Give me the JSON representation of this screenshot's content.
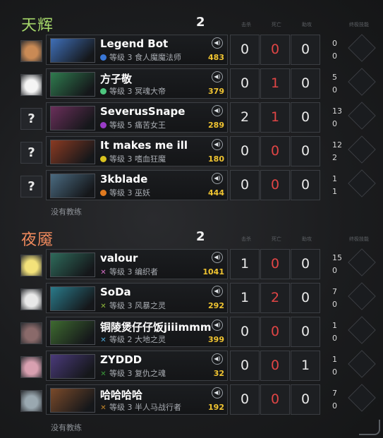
{
  "columns": {
    "kills": "击杀",
    "deaths": "死亡",
    "assists": "助攻",
    "ult": "终极技能"
  },
  "teams": [
    {
      "id": "radiant",
      "name": "天辉",
      "score": "2",
      "no_coach": "没有教练",
      "players": [
        {
          "avatar": "bot-dog-avatar",
          "avatar_text": "",
          "name": "Legend Bot",
          "level": "等级 3 食人魔魔法师",
          "badge_color": "#3a77d6",
          "badge": "dot",
          "gold": "483",
          "kills": "0",
          "deaths": "0",
          "assists": "0",
          "extra1": "0",
          "extra2": "0",
          "hero_color": "#3f6fb8"
        },
        {
          "avatar": "face-icon-avatar",
          "avatar_text": "",
          "name": "方子敬",
          "level": "等级 3 冥魂大帝",
          "badge_color": "#4ec77f",
          "badge": "dot",
          "gold": "379",
          "kills": "0",
          "deaths": "1",
          "assists": "0",
          "extra1": "5",
          "extra2": "0",
          "hero_color": "#2f7a4e"
        },
        {
          "avatar": "unknown-avatar",
          "avatar_text": "?",
          "name": "SeverusSnape",
          "level": "等级 5 痛苦女王",
          "badge_color": "#9a3cc7",
          "badge": "dot",
          "gold": "289",
          "kills": "2",
          "deaths": "1",
          "assists": "0",
          "extra1": "13",
          "extra2": "0",
          "hero_color": "#6a2f5a"
        },
        {
          "avatar": "unknown-avatar",
          "avatar_text": "?",
          "name": "It makes me ill",
          "level": "等级 3 嗜血狂魔",
          "badge_color": "#d9c21f",
          "badge": "dot",
          "gold": "180",
          "kills": "0",
          "deaths": "0",
          "assists": "0",
          "extra1": "12",
          "extra2": "2",
          "hero_color": "#8a3a22"
        },
        {
          "avatar": "unknown-avatar",
          "avatar_text": "?",
          "name": "3kblade",
          "level": "等级 3 巫妖",
          "badge_color": "#e07a1f",
          "badge": "dot",
          "gold": "444",
          "kills": "0",
          "deaths": "0",
          "assists": "0",
          "extra1": "1",
          "extra2": "1",
          "hero_color": "#4a6a80"
        }
      ]
    },
    {
      "id": "dire",
      "name": "夜魇",
      "score": "2",
      "no_coach": "没有教练",
      "players": [
        {
          "avatar": "pikachu-avatar",
          "avatar_text": "",
          "name": "valour",
          "level": "等级 3 编织者",
          "badge_color": "#d870c8",
          "badge": "x",
          "gold": "1041",
          "kills": "1",
          "deaths": "0",
          "assists": "0",
          "extra1": "15",
          "extra2": "0",
          "hero_color": "#2e6a5a"
        },
        {
          "avatar": "anime-face-avatar",
          "avatar_text": "",
          "name": "SoDa",
          "level": "等级 3 风暴之灵",
          "badge_color": "#8fb83a",
          "badge": "x",
          "gold": "292",
          "kills": "1",
          "deaths": "2",
          "assists": "0",
          "extra1": "7",
          "extra2": "0",
          "hero_color": "#2a7a8a"
        },
        {
          "avatar": "cat-avatar",
          "avatar_text": "",
          "name": "铜陵煲仔仔饭jiiimmm",
          "level": "等级 2 大地之灵",
          "badge_color": "#4ea8d6",
          "badge": "x",
          "gold": "399",
          "kills": "0",
          "deaths": "0",
          "assists": "0",
          "extra1": "1",
          "extra2": "0",
          "hero_color": "#3e6a30"
        },
        {
          "avatar": "girl-avatar",
          "avatar_text": "",
          "name": "ZYDDD",
          "level": "等级 3 复仇之魂",
          "badge_color": "#3a9a3a",
          "badge": "x",
          "gold": "32",
          "kills": "0",
          "deaths": "0",
          "assists": "1",
          "extra1": "1",
          "extra2": "0",
          "hero_color": "#4a3a7a"
        },
        {
          "avatar": "portrait-avatar",
          "avatar_text": "",
          "name": "哈哈哈哈",
          "level": "等级 3 半人马战行者",
          "badge_color": "#c4872a",
          "badge": "x",
          "gold": "192",
          "kills": "0",
          "deaths": "0",
          "assists": "0",
          "extra1": "7",
          "extra2": "0",
          "hero_color": "#7a4a2a"
        }
      ]
    }
  ]
}
